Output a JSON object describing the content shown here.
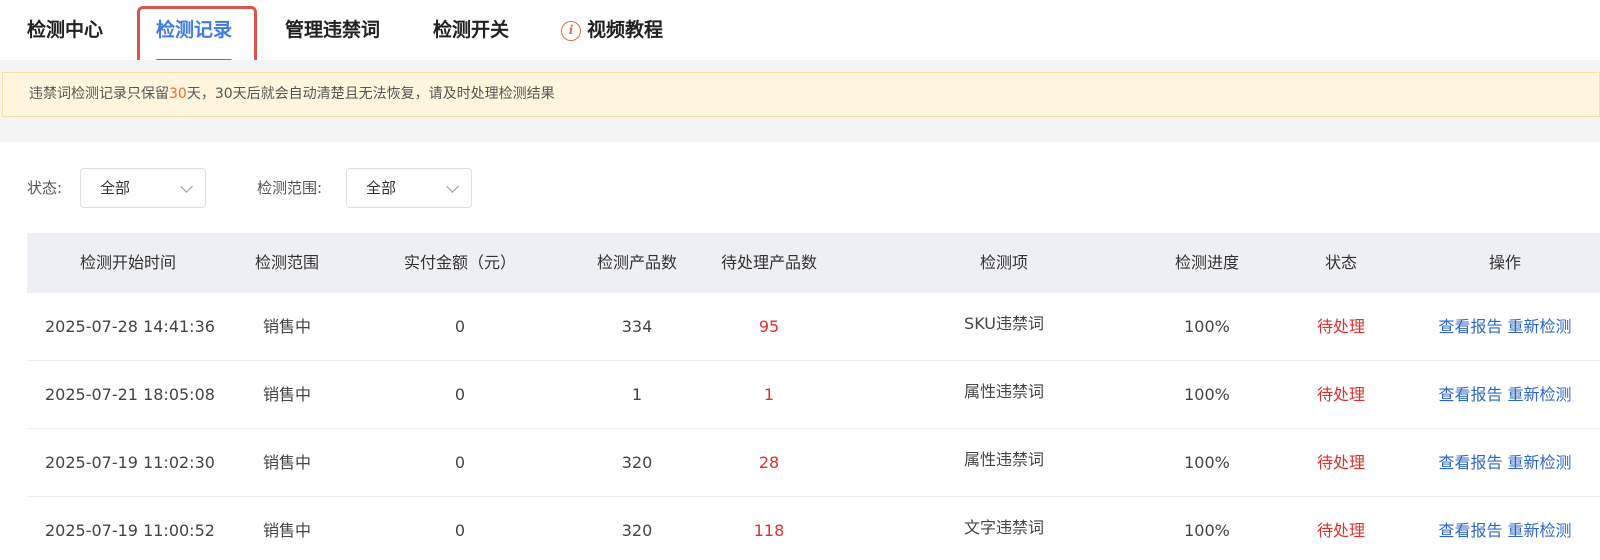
{
  "tabs": [
    {
      "label": "检测中心"
    },
    {
      "label": "检测记录"
    },
    {
      "label": "管理违禁词"
    },
    {
      "label": "检测开关"
    },
    {
      "label": "视频教程",
      "icon": "info-icon"
    }
  ],
  "active_tab_index": 1,
  "notice": {
    "before": "违禁词检测记录只保留",
    "highlight": "30",
    "after": "天，30天后就会自动清楚且无法恢复，请及时处理检测结果"
  },
  "filters": {
    "status_label": "状态:",
    "status_value": "全部",
    "scope_label": "检测范围:",
    "scope_value": "全部"
  },
  "table": {
    "headers": [
      "检测开始时间",
      "检测范围",
      "实付金额（元）",
      "检测产品数",
      "待处理产品数",
      "检测项",
      "检测进度",
      "状态",
      "操作"
    ],
    "rows": [
      {
        "start_time": "2025-07-28 14:41:36",
        "scope": "销售中",
        "amount": "0",
        "product_count": "334",
        "pending_count": "95",
        "item": "SKU违禁词",
        "progress": "100%",
        "status": "待处理",
        "action_view": "查看报告",
        "action_recheck": "重新检测"
      },
      {
        "start_time": "2025-07-21 18:05:08",
        "scope": "销售中",
        "amount": "0",
        "product_count": "1",
        "pending_count": "1",
        "item": "属性违禁词",
        "progress": "100%",
        "status": "待处理",
        "action_view": "查看报告",
        "action_recheck": "重新检测"
      },
      {
        "start_time": "2025-07-19 11:02:30",
        "scope": "销售中",
        "amount": "0",
        "product_count": "320",
        "pending_count": "28",
        "item": "属性违禁词",
        "progress": "100%",
        "status": "待处理",
        "action_view": "查看报告",
        "action_recheck": "重新检测"
      },
      {
        "start_time": "2025-07-19 11:00:52",
        "scope": "销售中",
        "amount": "0",
        "product_count": "320",
        "pending_count": "118",
        "item": "文字违禁词",
        "progress": "100%",
        "status": "待处理",
        "action_view": "查看报告",
        "action_recheck": "重新检测"
      }
    ]
  },
  "colors": {
    "accent": "#3f7be0",
    "danger": "#e02f2f",
    "link": "#2e67c7",
    "notice_bg": "#fdf6dd",
    "highlight_box": "#d9534f"
  }
}
